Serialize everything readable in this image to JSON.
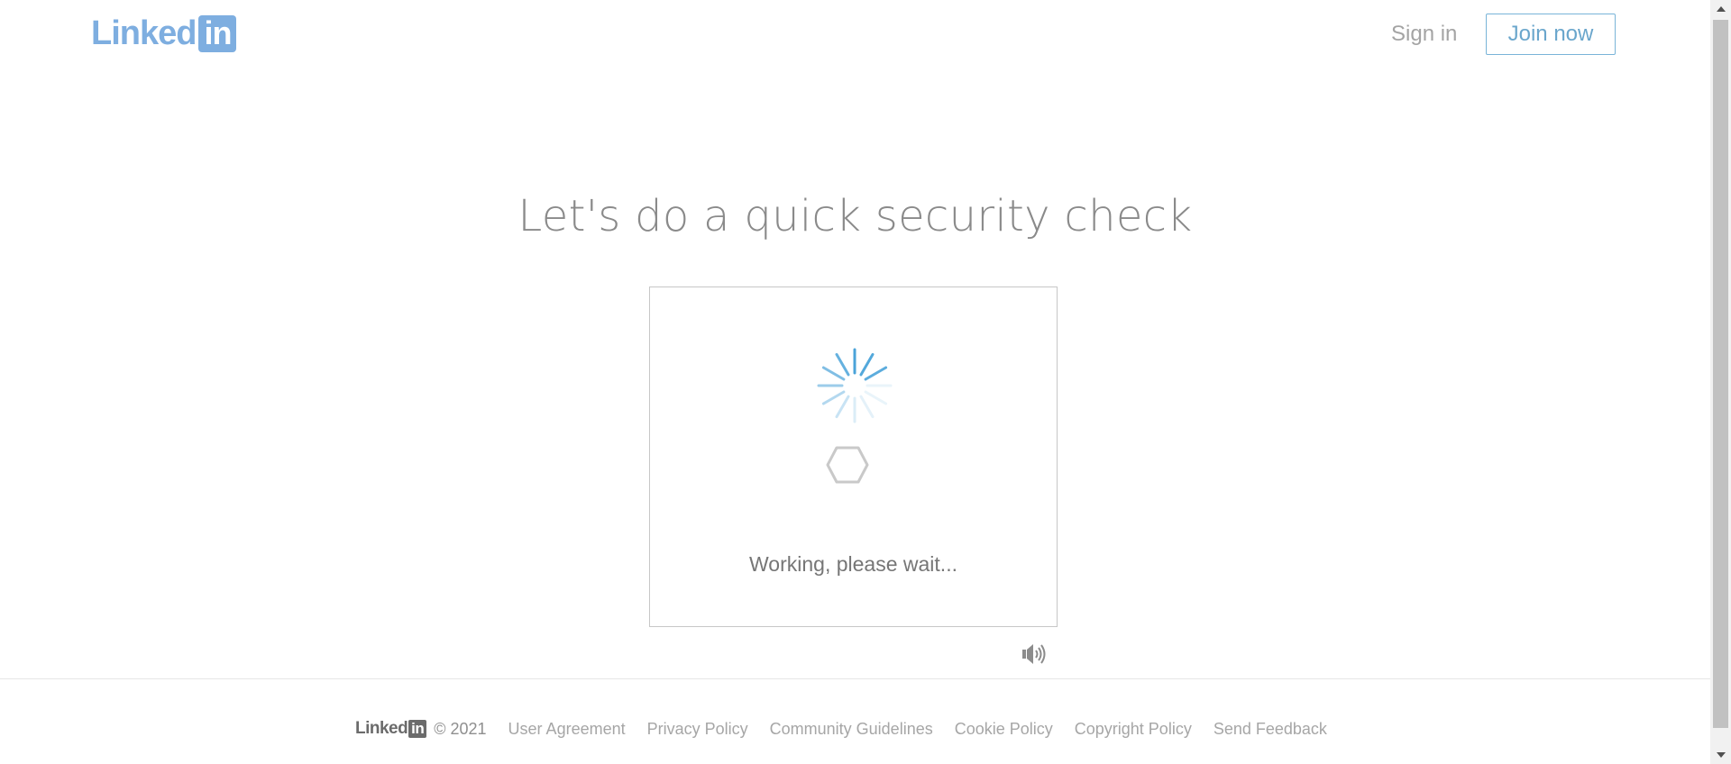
{
  "header": {
    "logo_text": "Linked",
    "logo_box_text": "in",
    "signin_label": "Sign in",
    "join_label": "Join now"
  },
  "main": {
    "heading": "Let's do a quick security check",
    "status_text": "Working, please wait...",
    "audio_icon": "speaker-icon",
    "spinner_icon": "loading-spinner-icon",
    "hexagon_icon": "hexagon-icon"
  },
  "footer": {
    "logo_text": "Linked",
    "logo_box_text": "in",
    "copyright": "© 2021",
    "links": [
      "User Agreement",
      "Privacy Policy",
      "Community Guidelines",
      "Cookie Policy",
      "Copyright Policy",
      "Send Feedback"
    ]
  },
  "colors": {
    "brand_blue": "#7eaee0",
    "join_border": "#79b4d8",
    "text_gray": "#8a8a8a",
    "footer_link": "#a6a6a6"
  }
}
